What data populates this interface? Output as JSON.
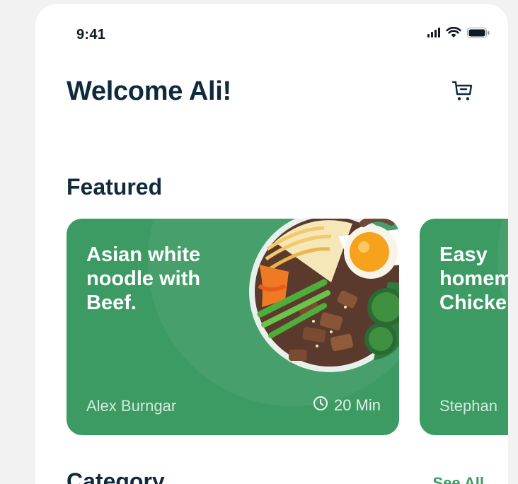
{
  "status_bar": {
    "time": "9:41"
  },
  "header": {
    "title": "Welcome Ali!"
  },
  "featured": {
    "title": "Featured",
    "cards": [
      {
        "title": "Asian white noodle with Beef.",
        "author": "Alex Burngar",
        "duration": "20 Min"
      },
      {
        "title": "Easy homemade Chicken",
        "author": "Stephan"
      }
    ]
  },
  "category": {
    "title": "Category",
    "see_all": "See All"
  },
  "colors": {
    "accent": "#3c9b63",
    "heading": "#0f2a3a",
    "background": "#f2f2f2"
  },
  "icons": {
    "cart": "cart-icon",
    "clock": "clock-icon"
  }
}
